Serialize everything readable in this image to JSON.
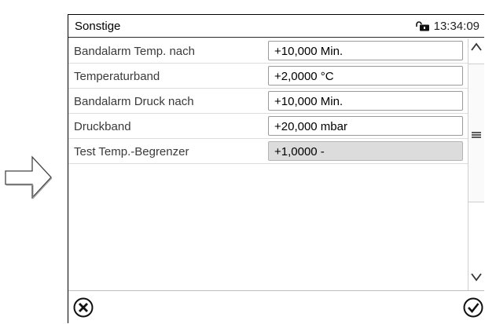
{
  "header": {
    "title": "Sonstige",
    "time": "13:34:09"
  },
  "rows": [
    {
      "label": "Bandalarm Temp. nach",
      "value": "+10,000 Min."
    },
    {
      "label": "Temperaturband",
      "value": "+2,0000 °C"
    },
    {
      "label": "Bandalarm Druck nach",
      "value": "+10,000 Min."
    },
    {
      "label": "Druckband",
      "value": "+20,000 mbar"
    },
    {
      "label": "Test Temp.-Begrenzer",
      "value": "+1,0000 -"
    }
  ],
  "icons": {
    "pointer": "right-arrow-icon",
    "lock": "unlock-icon",
    "scroll_up": "chevron-up-icon",
    "scroll_grip": "grip-lines-icon",
    "scroll_down": "chevron-down-icon",
    "cancel": "cancel-circle-icon",
    "confirm": "check-circle-icon"
  }
}
